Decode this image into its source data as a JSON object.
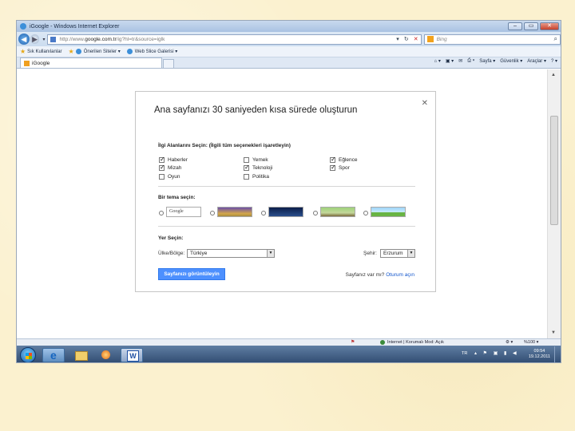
{
  "window": {
    "title": "iGoogle - Windows Internet Explorer",
    "url_prefix": "http://www.",
    "url_domain": "google.com.tr",
    "url_suffix": "/ig?hl=tr&source=iglk",
    "search_placeholder": "Bing"
  },
  "favorites_bar": {
    "favorites": "Sık Kullanılanlar",
    "suggested": "Önerilen Siteler ▾",
    "webslice": "Web Slice Galerisi ▾"
  },
  "tab": {
    "label": "iGoogle"
  },
  "command_bar": {
    "page": "Sayfa ▾",
    "safety": "Güvenlik ▾",
    "tools": "Araçlar ▾"
  },
  "dialog": {
    "title": "Ana sayfanızı 30 saniyeden kısa sürede oluşturun",
    "interests_heading": "İlgi Alanlarını Seçin: (İlgili tüm seçenekleri işaretleyin)",
    "interests": [
      {
        "label": "Haberler",
        "checked": true
      },
      {
        "label": "Mizah",
        "checked": true
      },
      {
        "label": "Oyun",
        "checked": false
      },
      {
        "label": "Yemek",
        "checked": false
      },
      {
        "label": "Teknoloji",
        "checked": true
      },
      {
        "label": "Politika",
        "checked": false
      },
      {
        "label": "Eğlence",
        "checked": true
      },
      {
        "label": "Spor",
        "checked": true
      }
    ],
    "theme_heading": "Bir tema seçin:",
    "theme_first_label": "Google",
    "location_heading": "Yer Seçin:",
    "country_label": "Ülke/Bölge:",
    "country_value": "Türkiye",
    "city_label": "Şehir:",
    "city_value": "Erzurum",
    "submit_label": "Sayfanızı görüntüleyin",
    "has_page_text": "Sayfanız var mı?",
    "signin_link": "Oturum açın"
  },
  "status_bar": {
    "zone": "Internet | Korumalı Mod: Açık",
    "zoom": "%100 ▾"
  },
  "taskbar": {
    "lang": "TR",
    "time": "09:54",
    "date": "19.12.2011"
  }
}
